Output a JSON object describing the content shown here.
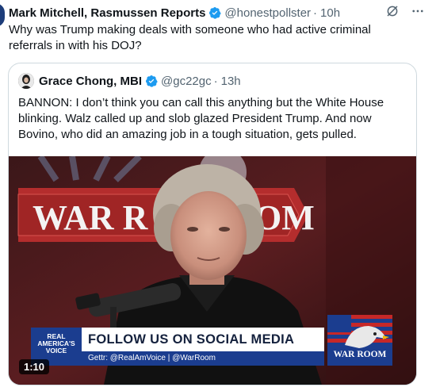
{
  "tweet": {
    "author_name": "Mark Mitchell, Rasmussen Reports",
    "handle": "@honestpollster",
    "dot": "·",
    "time": "10h",
    "text": "Why was Trump making deals with someone who had active criminal referrals in with his DOJ?",
    "icons": [
      "verified-badge-icon",
      "grok-icon",
      "more-icon"
    ]
  },
  "quoted": {
    "author_name": "Grace Chong, MBI",
    "handle": "@gc22gc",
    "dot": "·",
    "time": "13h",
    "text": "BANNON: I don’t think you can call this anything but the White House blinking. Walz called up and slob glazed President Trump. And now Bovino, who did an amazing job in a tough situation, gets pulled."
  },
  "video": {
    "duration": "1:10",
    "backdrop_sign": "WAR R",
    "backdrop_sign_tail": "OM",
    "channel_logo": "REAL AMERICA'S VOICE",
    "headline": "FOLLOW US ON SOCIAL MEDIA",
    "subline": "Gettr: @RealAmVoice | @WarRoom",
    "badge": "WAR ROOM"
  },
  "colors": {
    "verified": "#1d9bf0",
    "text_primary": "#0f1419",
    "text_secondary": "#536471",
    "border": "#cfd9de",
    "rav_blue": "#1b3d8f"
  }
}
